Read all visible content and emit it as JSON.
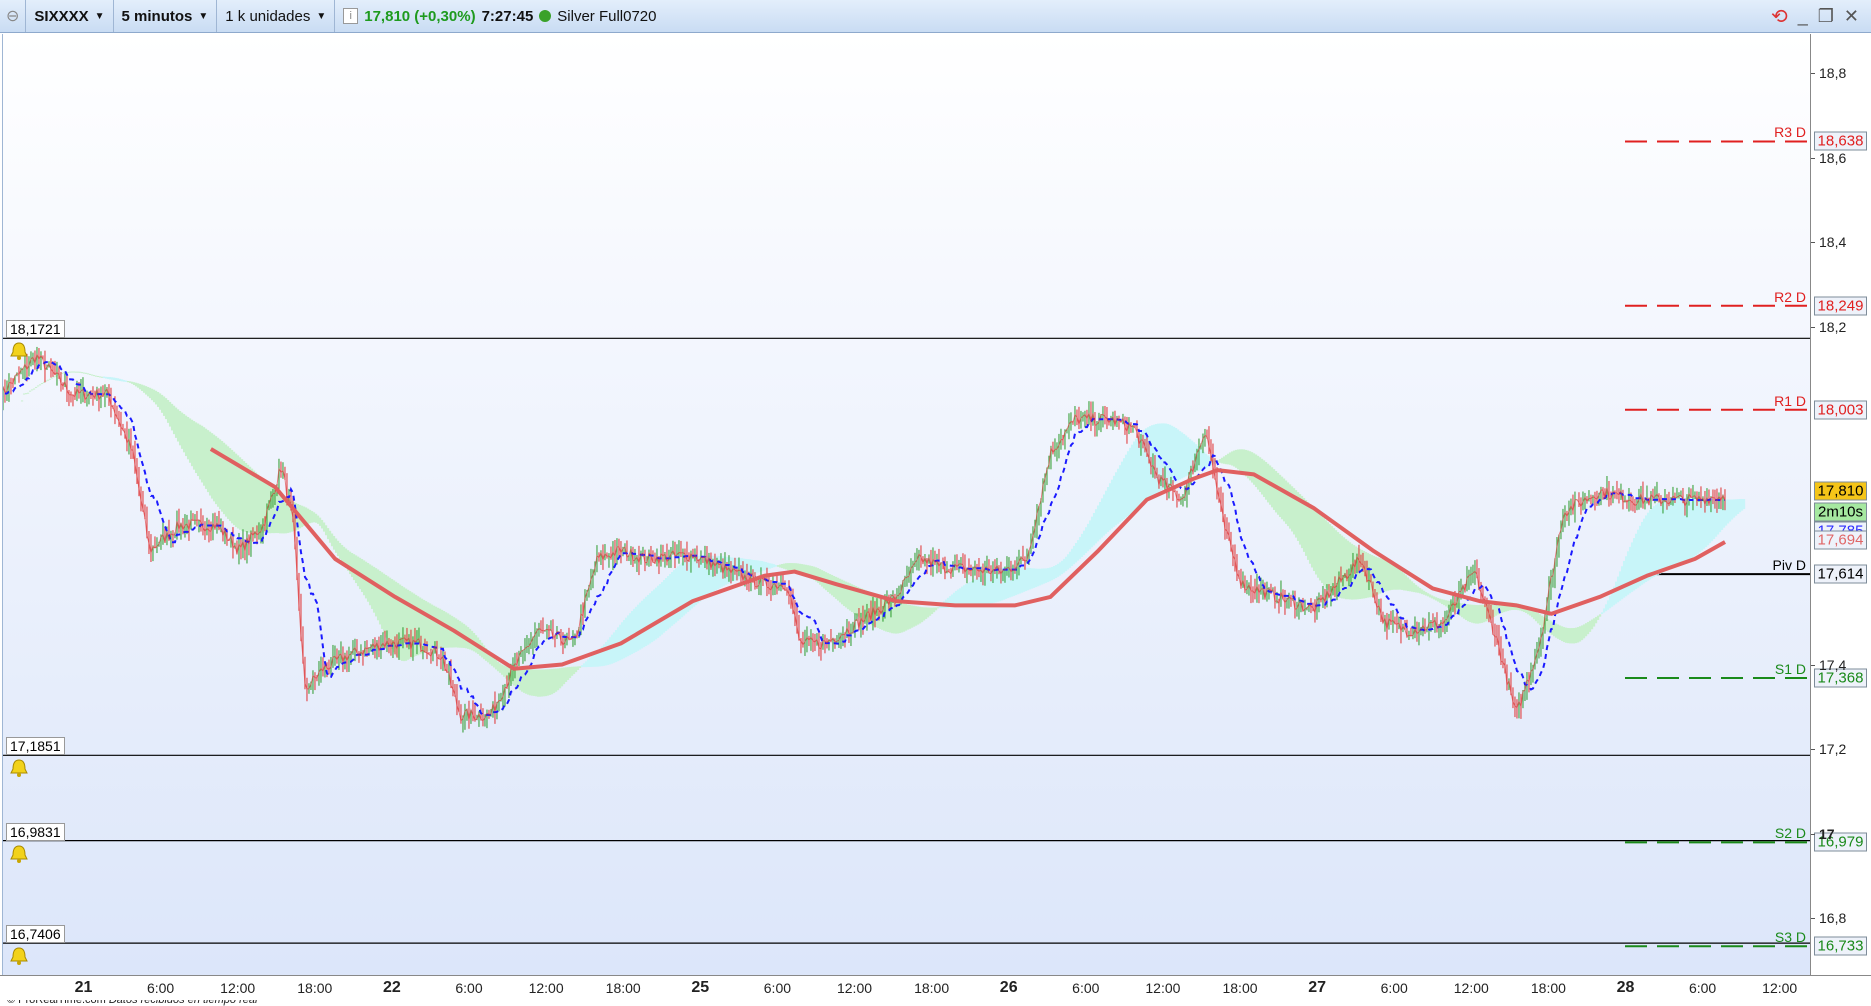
{
  "toolbar": {
    "symbol": "SIXXXX",
    "timeframe": "5 minutos",
    "units": "1 k unidades",
    "price_change": "17,810 (+0,30%)",
    "time": "7:27:45",
    "feed": "Silver Full0720",
    "status_color": "#3aa12a",
    "change_color": "#1e9a1e",
    "icons": [
      "link-icon",
      "info-icon",
      "refresh-icon",
      "minimize-icon",
      "restore-icon",
      "close-icon"
    ]
  },
  "price_axis": {
    "ticks": [
      {
        "value": 18.8,
        "label": "18,8"
      },
      {
        "value": 18.6,
        "label": "18,6"
      },
      {
        "value": 18.4,
        "label": "18,4"
      },
      {
        "value": 18.2,
        "label": "18,2"
      },
      {
        "value": 17.4,
        "label": "17,4"
      },
      {
        "value": 17.2,
        "label": "17,2"
      },
      {
        "value": 17.0,
        "label": "17"
      },
      {
        "value": 16.8,
        "label": "16,8"
      }
    ],
    "markers": [
      {
        "value": 17.81,
        "label": "17,810",
        "bg": "#f5c518",
        "color": "#000"
      },
      {
        "value": 17.76,
        "label": "2m10s",
        "bg": "#a6e8a0",
        "color": "#000"
      },
      {
        "value": 17.785,
        "label": "17,785",
        "bg": "#eef2fa",
        "color": "#2a2aff"
      },
      {
        "value": 17.694,
        "label": "17,694",
        "bg": "#eef2fa",
        "color": "#e06666"
      },
      {
        "value": 17.614,
        "label": "17,614",
        "bg": "#eef2fa",
        "color": "#000"
      }
    ]
  },
  "pivot_levels": [
    {
      "name": "R3 D",
      "value": 18.638,
      "label": "18,638",
      "color": "#e02020"
    },
    {
      "name": "R2 D",
      "value": 18.249,
      "label": "18,249",
      "color": "#e02020"
    },
    {
      "name": "R1 D",
      "value": 18.003,
      "label": "18,003",
      "color": "#e02020"
    },
    {
      "name": "Piv D",
      "value": 17.614,
      "label": "17,614",
      "color": "#000000"
    },
    {
      "name": "S1 D",
      "value": 17.368,
      "label": "17,368",
      "color": "#1a8a1a"
    },
    {
      "name": "S2 D",
      "value": 16.979,
      "label": "16,979",
      "color": "#1a8a1a"
    },
    {
      "name": "S3 D",
      "value": 16.733,
      "label": "16,733",
      "color": "#1a8a1a"
    }
  ],
  "alerts": [
    {
      "value": 18.1721,
      "label": "18,1721"
    },
    {
      "value": 17.1851,
      "label": "17,1851"
    },
    {
      "value": 16.9831,
      "label": "16,9831"
    },
    {
      "value": 16.7406,
      "label": "16,7406"
    }
  ],
  "time_axis": {
    "days": [
      "21",
      "22",
      "25",
      "26",
      "27",
      "28"
    ],
    "hours": [
      "6:00",
      "12:00",
      "18:00"
    ]
  },
  "chart_data": {
    "type": "line",
    "series": [
      {
        "color": "#e03030",
        "points": [
          [
            "20 17:30",
            18.04
          ],
          [
            "20 20:15",
            18.13
          ],
          [
            "20 23:05",
            18.04
          ],
          [
            "21 01:50",
            18.04
          ],
          [
            "21 03:45",
            17.9
          ],
          [
            "21 05:05",
            17.67
          ],
          [
            "21 07:25",
            17.73
          ],
          [
            "21 10:15",
            17.73
          ],
          [
            "21 12:05",
            17.67
          ],
          [
            "21 13:55",
            17.73
          ],
          [
            "21 15:20",
            17.87
          ],
          [
            "21 16:15",
            17.73
          ],
          [
            "21 17:10",
            17.34
          ],
          [
            "21 18:35",
            17.39
          ],
          [
            "21 20:25",
            17.42
          ],
          [
            "21 23:15",
            17.45
          ],
          [
            "22 02:00",
            17.45
          ],
          [
            "22 03:50",
            17.42
          ],
          [
            "22 05:15",
            17.28
          ],
          [
            "22 07:35",
            17.28
          ],
          [
            "22 09:25",
            17.39
          ],
          [
            "22 11:15",
            17.48
          ],
          [
            "22 14:05",
            17.45
          ],
          [
            "22 15:55",
            17.65
          ],
          [
            "22 17:45",
            17.67
          ],
          [
            "22 19:40",
            17.65
          ],
          [
            "22 23:20",
            17.66
          ],
          [
            "25 02:10",
            17.62
          ],
          [
            "25 04:55",
            17.59
          ],
          [
            "25 06:45",
            17.59
          ],
          [
            "25 07:40",
            17.45
          ],
          [
            "25 09:35",
            17.45
          ],
          [
            "25 12:20",
            17.5
          ],
          [
            "25 15:10",
            17.56
          ],
          [
            "25 17:00",
            17.65
          ],
          [
            "25 18:50",
            17.63
          ],
          [
            "25 23:30",
            17.62
          ],
          [
            "26 01:20",
            17.65
          ],
          [
            "26 03:10",
            17.9
          ],
          [
            "26 05:05",
            17.98
          ],
          [
            "26 07:50",
            17.98
          ],
          [
            "26 09:40",
            17.96
          ],
          [
            "26 11:35",
            17.84
          ],
          [
            "26 13:25",
            17.79
          ],
          [
            "26 15:15",
            17.96
          ],
          [
            "26 16:40",
            17.73
          ],
          [
            "26 18:05",
            17.59
          ],
          [
            "26 20:50",
            17.56
          ],
          [
            "26 23:40",
            17.53
          ],
          [
            "27 03:20",
            17.65
          ],
          [
            "27 05:10",
            17.5
          ],
          [
            "27 07:05",
            17.48
          ],
          [
            "27 09:50",
            17.5
          ],
          [
            "27 12:10",
            17.62
          ],
          [
            "27 14:00",
            17.45
          ],
          [
            "27 15:25",
            17.28
          ],
          [
            "27 17:15",
            17.45
          ],
          [
            "27 19:05",
            17.76
          ],
          [
            "27 21:55",
            17.81
          ],
          [
            "28 00:40",
            17.79
          ],
          [
            "28 03:30",
            17.79
          ],
          [
            "28 05:20",
            17.79
          ],
          [
            "28 07:40",
            17.8
          ]
        ]
      },
      {
        "color": "#e06060",
        "points": [
          [
            "21 09:50",
            17.91
          ],
          [
            "21 14:50",
            17.82
          ],
          [
            "21 19:30",
            17.65
          ],
          [
            "22 00:10",
            17.56
          ],
          [
            "22 04:45",
            17.48
          ],
          [
            "22 09:25",
            17.39
          ],
          [
            "22 13:10",
            17.4
          ],
          [
            "22 17:45",
            17.45
          ],
          [
            "22 23:20",
            17.55
          ],
          [
            "25 04:55",
            17.61
          ],
          [
            "25 07:15",
            17.62
          ],
          [
            "25 10:30",
            17.59
          ],
          [
            "25 15:10",
            17.55
          ],
          [
            "25 19:45",
            17.54
          ],
          [
            "26 00:25",
            17.54
          ],
          [
            "26 03:10",
            17.56
          ],
          [
            "26 06:55",
            17.67
          ],
          [
            "26 10:40",
            17.79
          ],
          [
            "26 14:20",
            17.84
          ],
          [
            "26 16:10",
            17.86
          ],
          [
            "26 19:00",
            17.85
          ],
          [
            "26 23:40",
            17.77
          ],
          [
            "27 04:15",
            17.67
          ],
          [
            "27 08:55",
            17.58
          ],
          [
            "27 12:35",
            17.55
          ],
          [
            "27 15:25",
            17.54
          ],
          [
            "27 18:10",
            17.52
          ],
          [
            "27 21:55",
            17.56
          ],
          [
            "28 01:35",
            17.61
          ],
          [
            "28 05:20",
            17.65
          ],
          [
            "28 07:40",
            17.69
          ]
        ]
      }
    ],
    "ylim": [
      16.7,
      18.85
    ],
    "grid": false
  },
  "footer": {
    "copyright": "© ProRealTime.com",
    "status": "Datos recibidos en tiempo real"
  }
}
